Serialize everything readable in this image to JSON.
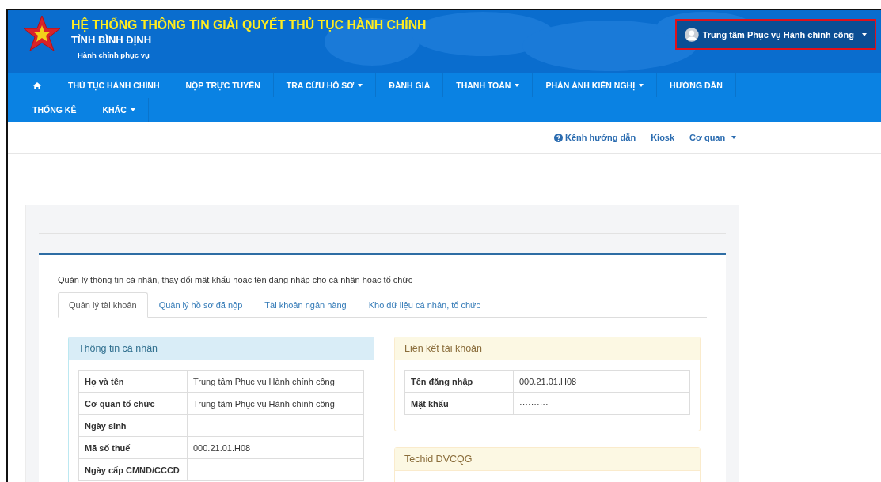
{
  "header": {
    "title": "HỆ THỐNG THÔNG TIN GIẢI QUYẾT THỦ TỤC HÀNH CHÍNH",
    "subtitle": "TỈNH BÌNH ĐỊNH",
    "slogan": "Hành chính phục vụ",
    "user": {
      "name": "Trung tâm Phục vụ Hành chính công",
      "highlighted": true
    }
  },
  "nav": [
    {
      "kind": "home"
    },
    {
      "kind": "text",
      "label": "THỦ TỤC HÀNH CHÍNH",
      "dropdown": false
    },
    {
      "kind": "text",
      "label": "NỘP TRỰC TUYẾN",
      "dropdown": false
    },
    {
      "kind": "text",
      "label": "TRA CỨU HỒ SƠ",
      "dropdown": true
    },
    {
      "kind": "text",
      "label": "ĐÁNH GIÁ",
      "dropdown": false
    },
    {
      "kind": "text",
      "label": "THANH TOÁN",
      "dropdown": true
    },
    {
      "kind": "text",
      "label": "PHẢN ÁNH KIẾN NGHỊ",
      "dropdown": true
    },
    {
      "kind": "text",
      "label": "HƯỚNG DẪN",
      "dropdown": false
    },
    {
      "kind": "text",
      "label": "THỐNG KÊ",
      "dropdown": false
    },
    {
      "kind": "text",
      "label": "KHÁC",
      "dropdown": true
    }
  ],
  "subnav": [
    {
      "kind": "help",
      "label": "Kênh hướng dẫn",
      "dropdown": false
    },
    {
      "kind": "text",
      "label": "Kiosk",
      "dropdown": false
    },
    {
      "kind": "text",
      "label": "Cơ quan",
      "dropdown": true
    }
  ],
  "description": "Quản lý thông tin cá nhân, thay đổi mật khẩu hoặc tên đăng nhập cho cá nhân hoặc tổ chức",
  "tabs": [
    {
      "label": "Quản lý tài khoản",
      "selected": true
    },
    {
      "label": "Quản lý hồ sơ đã nộp",
      "selected": false
    },
    {
      "label": "Tài khoản ngân hàng",
      "selected": false
    },
    {
      "label": "Kho dữ liệu cá nhân, tổ chức",
      "selected": false
    }
  ],
  "personal": {
    "title": "Thông tin cá nhân",
    "rows": [
      {
        "label": "Họ và tên",
        "value": "Trung tâm Phục vụ Hành chính công"
      },
      {
        "label": "Cơ quan tổ chức",
        "value": "Trung tâm Phục vụ Hành chính công"
      },
      {
        "label": "Ngày sinh"
      },
      {
        "label": "Mã số thuế",
        "value": "000.21.01.H08"
      },
      {
        "label": "Ngày cấp CMND/CCCD"
      }
    ]
  },
  "account": {
    "title": "Liên kết tài khoản",
    "rows": [
      {
        "label": "Tên đăng nhập",
        "value": "000.21.01.H08"
      },
      {
        "label": "Mật khẩu",
        "value": "··········"
      }
    ]
  },
  "techid": {
    "title": "Techid DVCQG"
  }
}
